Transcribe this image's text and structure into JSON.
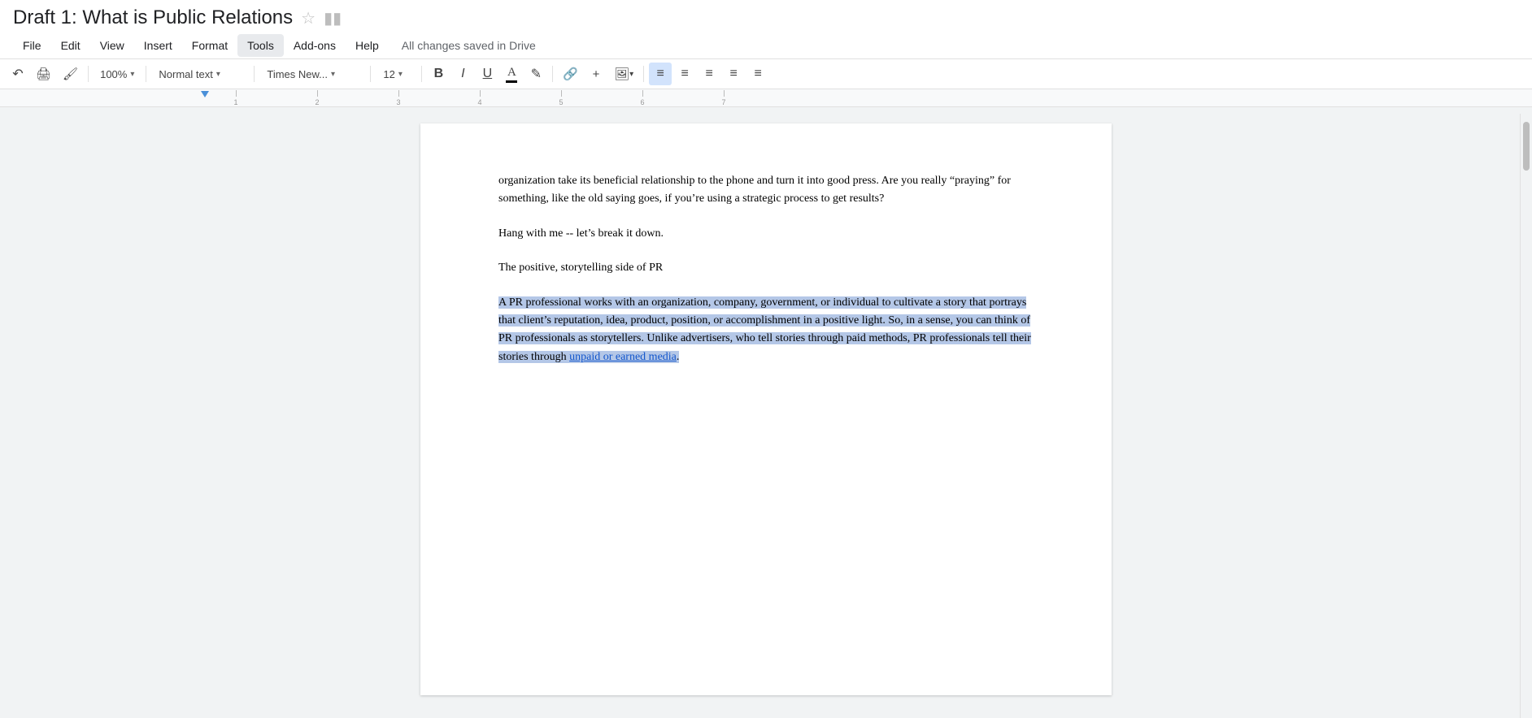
{
  "titleBar": {
    "title": "Draft 1: What is Public Relations",
    "starIcon": "☆",
    "folderIcon": "▬"
  },
  "menuBar": {
    "items": [
      "File",
      "Edit",
      "View",
      "Insert",
      "Format",
      "Tools",
      "Add-ons",
      "Help"
    ],
    "activeItem": "Tools",
    "savedStatus": "All changes saved in Drive"
  },
  "toolbar": {
    "undoIcon": "↩",
    "printIcon": "🖨",
    "paintIcon": "🖌",
    "zoomValue": "100%",
    "zoomArrow": "▾",
    "styleValue": "Normal text",
    "styleArrow": "▾",
    "fontValue": "Times New...",
    "fontArrow": "▾",
    "fontSize": "12",
    "fontSizeArrow": "▾",
    "boldLabel": "B",
    "italicLabel": "I",
    "underlineLabel": "U",
    "fontColorLabel": "A",
    "highlightLabel": "✏",
    "linkLabel": "🔗",
    "commentLabel": "💬",
    "imageLabel": "🖼",
    "imageArrow": "▾",
    "alignLeftLabel": "≡",
    "alignCenterLabel": "≡",
    "alignRightLabel": "≡",
    "alignJustifyLabel": "≡",
    "moreLabel": "≡"
  },
  "ruler": {
    "marks": [
      "1",
      "2",
      "3",
      "4",
      "5",
      "6",
      "7"
    ]
  },
  "document": {
    "paragraphs": [
      {
        "id": "p1",
        "text": "organization take its beneficial relationship to the phone and turn it into good press. Are you really “praying” for something, like the old saying goes, if you’re using a strategic process to get results?",
        "selected": false,
        "isTop": true
      },
      {
        "id": "p2",
        "text": "Hang with me -- let’s break it down.",
        "selected": false
      },
      {
        "id": "p3",
        "text": "The positive, storytelling side of PR",
        "selected": false
      },
      {
        "id": "p4",
        "text": "A PR professional works with an organization, company, government, or individual to cultivate a story that portrays that client’s reputation, idea, product, position, or accomplishment in a positive light. So, in a sense, you can think of PR professionals as storytellers. Unlike advertisers, who tell stories through paid methods, PR professionals tell their stories through ",
        "textEnd": "unpaid or earned media",
        "textAfter": ".",
        "selected": true,
        "hasLink": true
      }
    ]
  }
}
